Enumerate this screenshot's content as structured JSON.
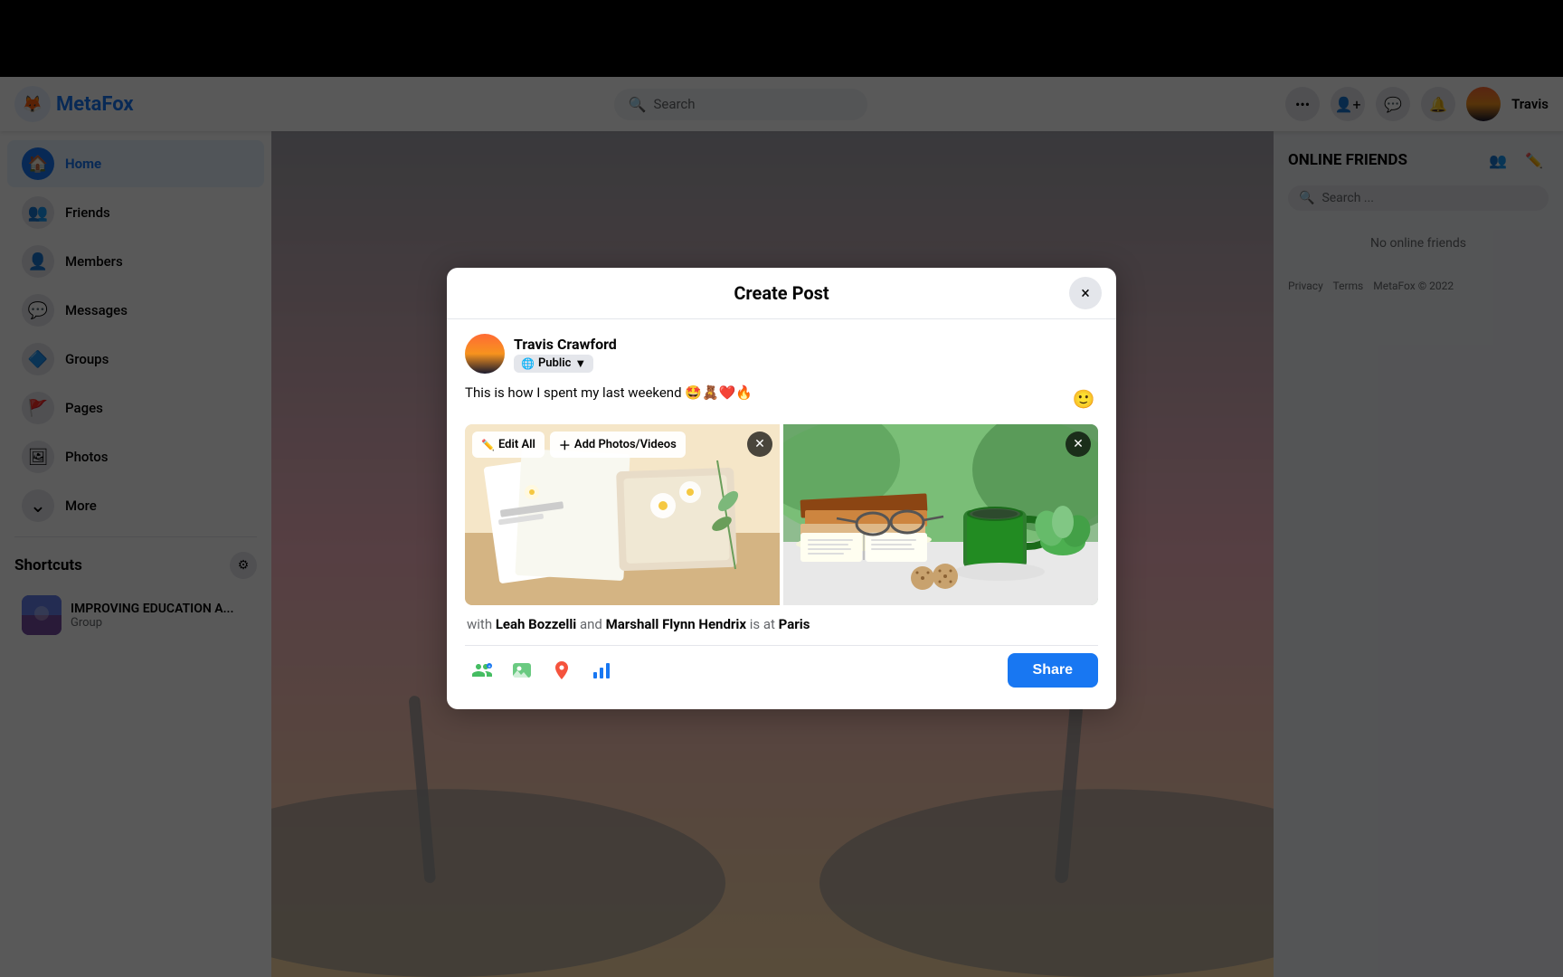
{
  "app": {
    "name": "MetaFox",
    "header": {
      "search_placeholder": "Search",
      "username": "Travis",
      "dots_label": "•••"
    }
  },
  "nav": {
    "items": [
      {
        "id": "home",
        "label": "Home",
        "icon": "🏠",
        "active": true
      },
      {
        "id": "friends",
        "label": "Friends",
        "icon": "👥",
        "active": false
      },
      {
        "id": "members",
        "label": "Members",
        "icon": "👤",
        "active": false
      },
      {
        "id": "messages",
        "label": "Messages",
        "icon": "💬",
        "active": false
      },
      {
        "id": "groups",
        "label": "Groups",
        "icon": "🔷",
        "active": false
      },
      {
        "id": "pages",
        "label": "Pages",
        "icon": "🚩",
        "active": false
      },
      {
        "id": "photos",
        "label": "Photos",
        "icon": "🖼",
        "active": false
      },
      {
        "id": "more",
        "label": "More",
        "icon": "⌄",
        "active": false
      }
    ],
    "shortcuts_title": "Shortcuts",
    "shortcut_items": [
      {
        "id": "edu",
        "name": "IMPROVING EDUCATION A...",
        "type": "Group"
      }
    ]
  },
  "right_sidebar": {
    "title": "ONLINE FRIENDS",
    "search_placeholder": "Search ...",
    "no_friends_text": "No online friends",
    "footer": {
      "privacy": "Privacy",
      "terms": "Terms",
      "copyright": "MetaFox © 2022"
    }
  },
  "modal": {
    "title": "Create Post",
    "close_label": "×",
    "user": {
      "name": "Travis Crawford",
      "privacy": "Public",
      "privacy_arrow": "▼"
    },
    "post_text": "This is how I spent my last weekend 🤩🧸❤️🔥",
    "emoji_icon": "🙂",
    "photos": {
      "edit_all_label": "Edit All",
      "add_label": "Add Photos/Videos",
      "photo1_alt": "Craft and flowers arrangement on wooden surface",
      "photo2_alt": "Books with coffee cup and cookies"
    },
    "tag_row": {
      "prefix": "with ",
      "person1": "Leah Bozzelli",
      "connector": " and ",
      "person2": "Marshall Flynn Hendrix",
      "location_prefix": " is at ",
      "location": "Paris"
    },
    "actions": {
      "share_label": "Share",
      "icons": [
        {
          "id": "tag-people",
          "icon": "👤+",
          "label": "Tag People"
        },
        {
          "id": "photo-video",
          "icon": "🖼",
          "label": "Photo/Video"
        },
        {
          "id": "location",
          "icon": "📍",
          "label": "Check In"
        },
        {
          "id": "activity",
          "icon": "📊",
          "label": "Activity"
        }
      ]
    }
  },
  "colors": {
    "brand_blue": "#1877f2",
    "share_btn_bg": "#1877f2",
    "modal_bg": "#ffffff",
    "sidebar_bg": "#ffffff",
    "page_bg": "#f0f2f5"
  }
}
